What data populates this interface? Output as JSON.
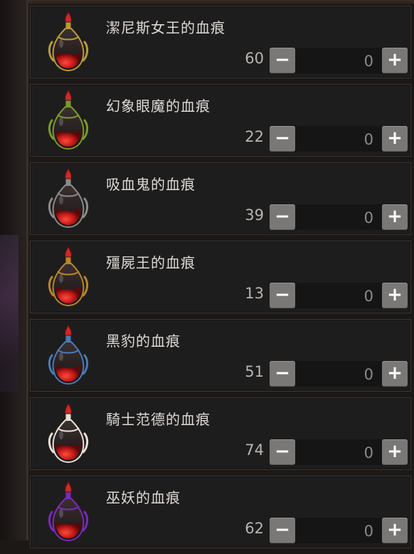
{
  "items": [
    {
      "name": "潔尼斯女王的血痕",
      "count": "60",
      "qty": "0",
      "minus": "−",
      "plus": "+",
      "accent": "#b89a3a",
      "icon": "potion-gold-dragon-icon"
    },
    {
      "name": "幻象眼魔的血痕",
      "count": "22",
      "qty": "0",
      "minus": "−",
      "plus": "+",
      "accent": "#7a9a2a",
      "icon": "potion-green-gems-icon"
    },
    {
      "name": "吸血鬼的血痕",
      "count": "39",
      "qty": "0",
      "minus": "−",
      "plus": "+",
      "accent": "#8a8a8a",
      "icon": "potion-silver-web-icon"
    },
    {
      "name": "殭屍王的血痕",
      "count": "13",
      "qty": "0",
      "minus": "−",
      "plus": "+",
      "accent": "#b8862a",
      "icon": "potion-gold-wrapped-icon"
    },
    {
      "name": "黑豹的血痕",
      "count": "51",
      "qty": "0",
      "minus": "−",
      "plus": "+",
      "accent": "#4a7ab8",
      "icon": "potion-blue-claw-icon"
    },
    {
      "name": "騎士范德的血痕",
      "count": "74",
      "qty": "0",
      "minus": "−",
      "plus": "+",
      "accent": "#e8e0d8",
      "icon": "potion-white-feather-icon"
    },
    {
      "name": "巫妖的血痕",
      "count": "62",
      "qty": "0",
      "minus": "−",
      "plus": "+",
      "accent": "#7a2ab8",
      "icon": "potion-purple-robe-icon"
    }
  ]
}
